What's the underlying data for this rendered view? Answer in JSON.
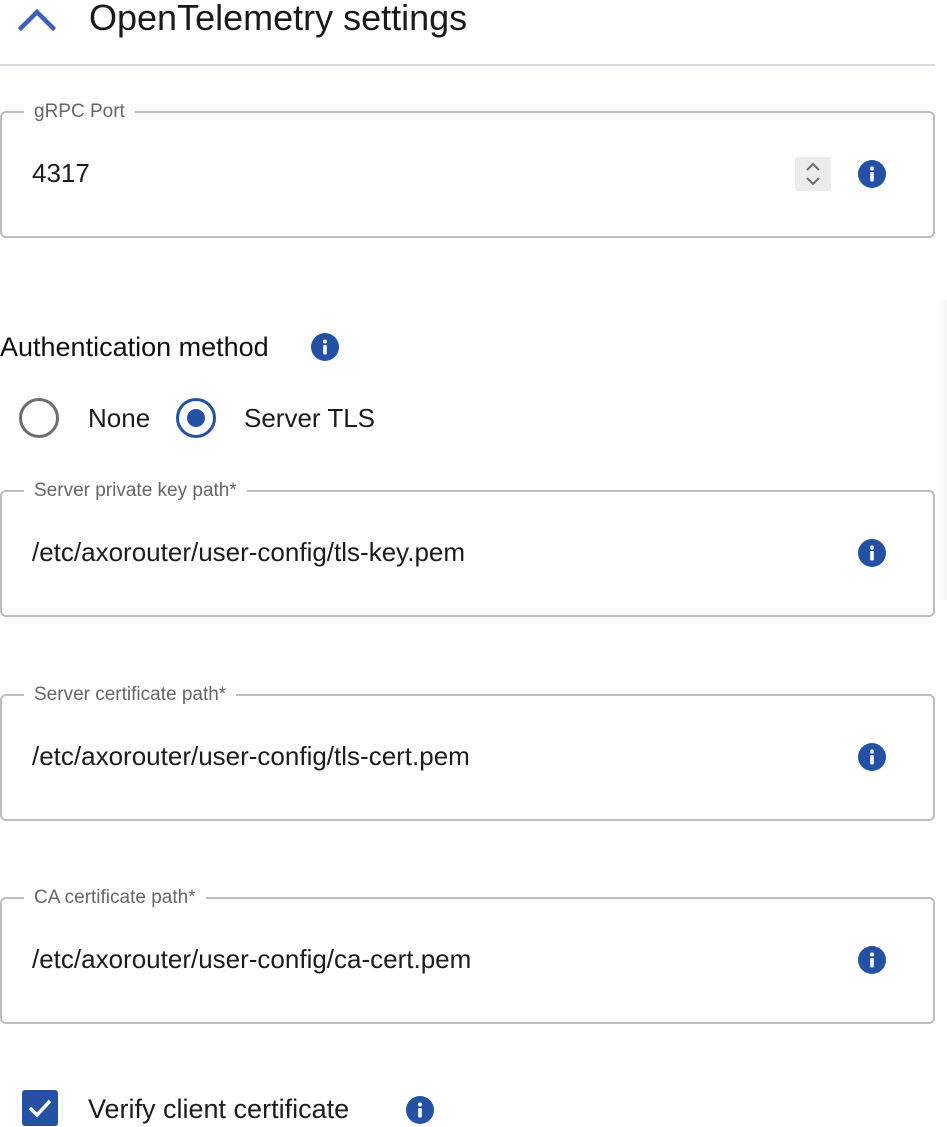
{
  "header": {
    "title": "OpenTelemetry settings",
    "collapse_icon": "chevron-up-icon"
  },
  "grpc_port": {
    "label": "gRPC Port",
    "value": "4317",
    "info_icon": "info-icon"
  },
  "authentication": {
    "title": "Authentication method",
    "options": [
      {
        "label": "None",
        "selected": false
      },
      {
        "label": "Server TLS",
        "selected": true
      }
    ]
  },
  "private_key_path": {
    "label": "Server private key path*",
    "value": "/etc/axorouter/user-config/tls-key.pem"
  },
  "certificate_path": {
    "label": "Server certificate path*",
    "value": "/etc/axorouter/user-config/tls-cert.pem"
  },
  "ca_certificate_path": {
    "label": "CA certificate path*",
    "value": "/etc/axorouter/user-config/ca-cert.pem"
  },
  "verify_client": {
    "label": "Verify client certificate",
    "checked": true
  },
  "colors": {
    "accent": "#2451a3",
    "border": "#bdbdbd",
    "label": "#666666"
  }
}
